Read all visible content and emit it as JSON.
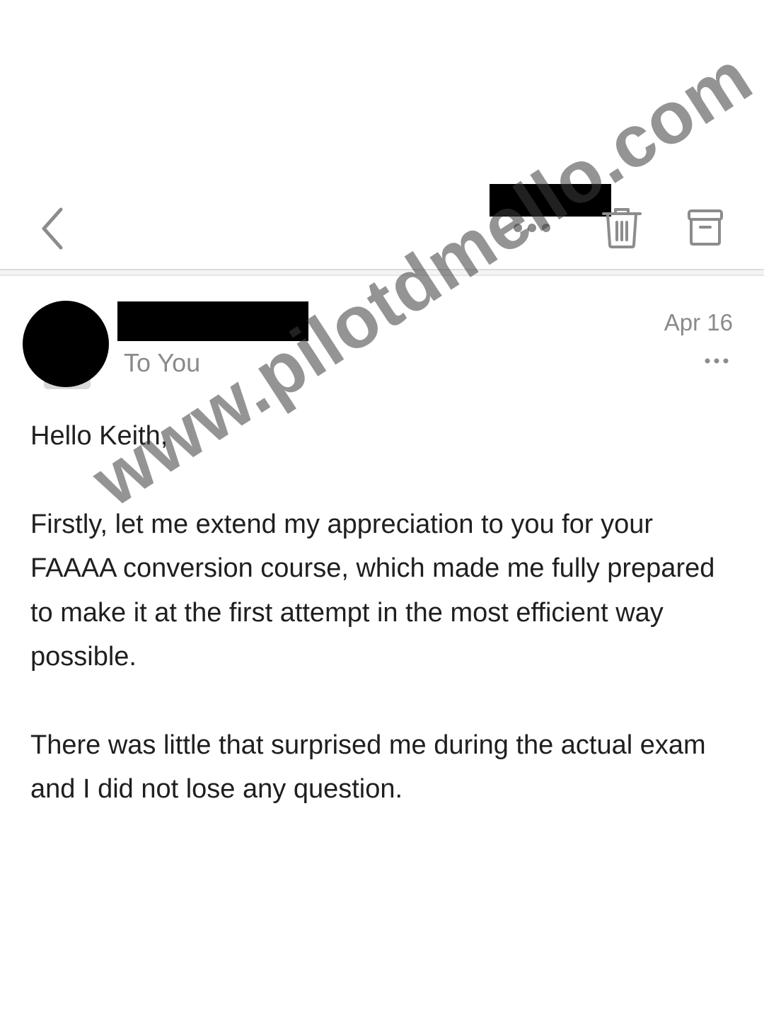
{
  "toolbar": {
    "back_icon": "chevron-left-icon",
    "more_icon": "more-horizontal-icon",
    "trash_icon": "trash-icon",
    "archive_icon": "archive-icon"
  },
  "message": {
    "recipient_line": "To You",
    "date": "Apr 16",
    "greeting": "Hello Keith,",
    "paragraphs": [
      "Firstly, let me extend my appreciation to you for your FAAAA conversion course, which made me fully prepared to make it at the first attempt in the most efficient way possible.",
      "There was little that surprised me during the actual exam and I did not lose any question."
    ]
  },
  "watermark": {
    "text": "www.pilotdmello.com"
  }
}
